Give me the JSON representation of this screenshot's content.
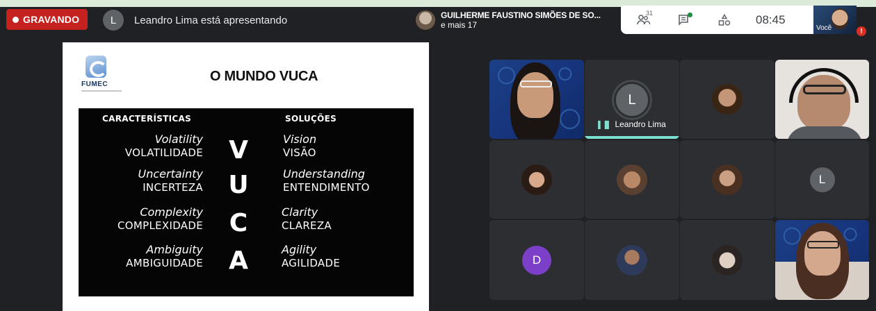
{
  "recording": {
    "label": "GRAVANDO",
    "color": "#c5221f"
  },
  "presenter": {
    "initial": "L",
    "text": "Leandro Lima está apresentando"
  },
  "others": {
    "name": "GUILHERME FAUSTINO SIMÕES DE SO...",
    "more": "e mais 17"
  },
  "toolbar": {
    "people_icon": "people-icon",
    "people_count": "31",
    "chat_icon": "chat-icon",
    "activities_icon": "activities-icon",
    "time": "08:45"
  },
  "self_view": {
    "label": "Você",
    "alert": "!"
  },
  "slide": {
    "logo_text": "FUMEC",
    "title": "O MUNDO VUCA",
    "left_header": "CARACTERÍSTICAS",
    "right_header": "SOLUÇÕES",
    "rows": [
      {
        "en_left": "Volatility",
        "pt_left": "VOLATILIDADE",
        "letter": "V",
        "en_right": "Vision",
        "pt_right": "VISÃO"
      },
      {
        "en_left": "Uncertainty",
        "pt_left": "INCERTEZA",
        "letter": "U",
        "en_right": "Understanding",
        "pt_right": "ENTENDIMENTO"
      },
      {
        "en_left": "Complexity",
        "pt_left": "COMPLEXIDADE",
        "letter": "C",
        "en_right": "Clarity",
        "pt_right": "CLAREZA"
      },
      {
        "en_left": "Ambiguity",
        "pt_left": "AMBIGUIDADE",
        "letter": "A",
        "en_right": "Agility",
        "pt_right": "AGILIDADE"
      }
    ]
  },
  "tiles": {
    "speaker_initial": "L",
    "speaker_name": "Leandro Lima",
    "initial_l": "L",
    "initial_d": "D"
  },
  "colors": {
    "meet_bg": "#202124",
    "tile": "#3c4043",
    "speaking": "#7be0d2",
    "d_avatar": "#7b3fc8"
  }
}
